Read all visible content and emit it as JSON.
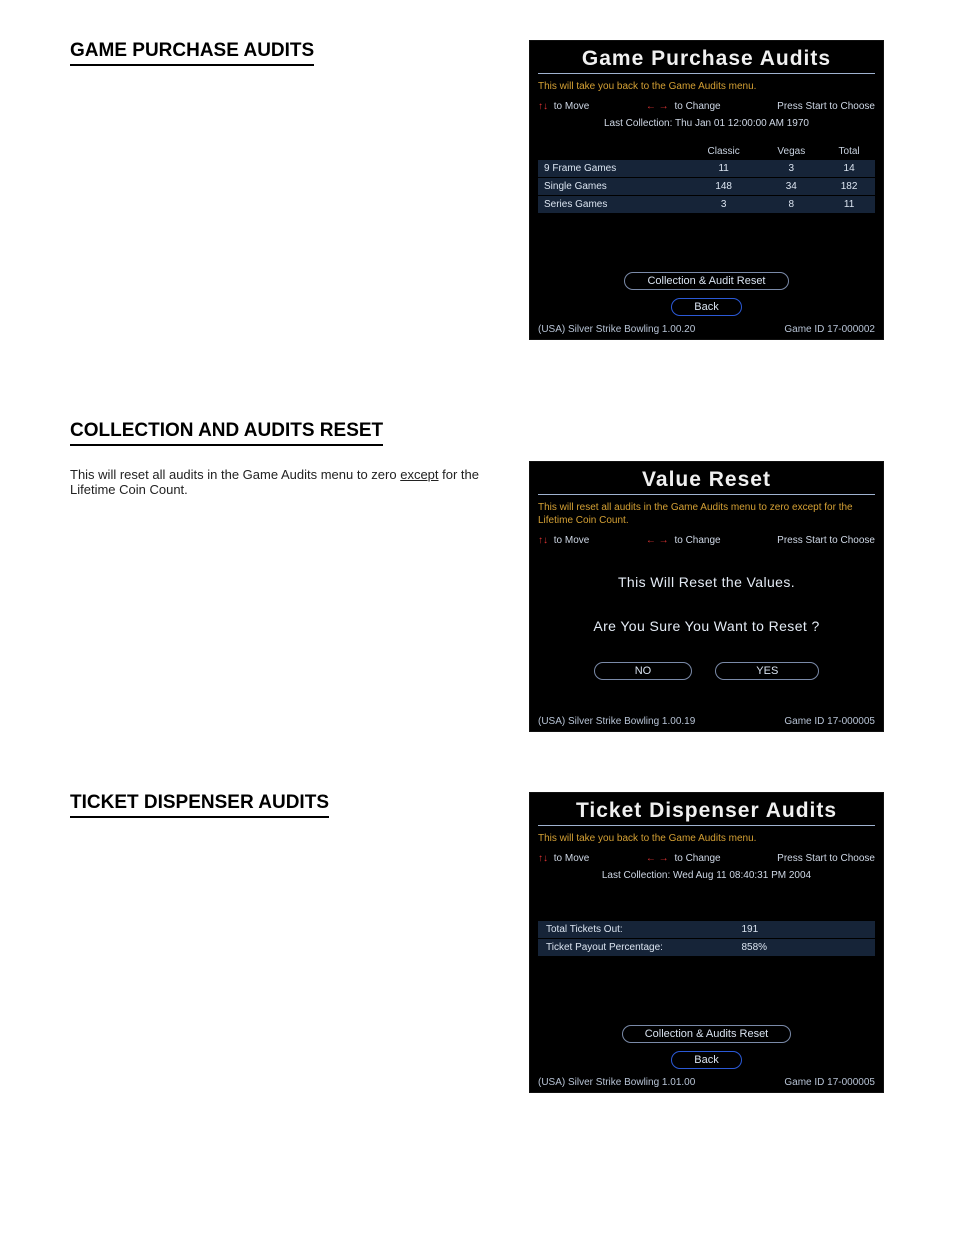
{
  "sections": {
    "purchase": {
      "heading": "GAME PURCHASE AUDITS"
    },
    "reset": {
      "heading": "COLLECTION AND AUDITS RESET",
      "note_pre": "This will reset all audits in the Game Audits menu to zero ",
      "note_u": "except",
      "note_post": " for the Lifetime Coin Count."
    },
    "ticket": {
      "heading": "TICKET DISPENSER AUDITS"
    }
  },
  "screen1": {
    "title": "Game Purchase Audits",
    "help": "This will take you back to the Game Audits menu.",
    "move": "to Move",
    "change": "to Change",
    "start": "Press Start to Choose",
    "collection_label": "Last Collection:",
    "collection_value": "Thu Jan 01 12:00:00 AM 1970",
    "cols": [
      "",
      "Classic",
      "Vegas",
      "Total"
    ],
    "rows": [
      [
        "9 Frame Games",
        "11",
        "3",
        "14"
      ],
      [
        "Single Games",
        "148",
        "34",
        "182"
      ],
      [
        "Series Games",
        "3",
        "8",
        "11"
      ]
    ],
    "btn_reset": "Collection & Audit Reset",
    "btn_back": "Back",
    "foot_left": "(USA) Silver Strike Bowling 1.00.20",
    "foot_right": "Game ID 17-000002"
  },
  "screen2": {
    "title": "Value Reset",
    "help": "This will reset all audits in the Game Audits menu to zero except for the Lifetime Coin Count.",
    "move": "to Move",
    "change": "to Change",
    "start": "Press Start to Choose",
    "msg1": "This Will Reset the Values.",
    "msg2": "Are You Sure You Want to Reset ?",
    "btn_no": "NO",
    "btn_yes": "YES",
    "foot_left": "(USA) Silver Strike Bowling 1.00.19",
    "foot_right": "Game ID 17-000005"
  },
  "screen3": {
    "title": "Ticket Dispenser Audits",
    "help": "This will take you back to the Game Audits menu.",
    "move": "to Move",
    "change": "to Change",
    "start": "Press Start to Choose",
    "collection_label": "Last Collection:",
    "collection_value": "Wed Aug 11 08:40:31 PM 2004",
    "rows": [
      [
        "Total Tickets Out:",
        "191"
      ],
      [
        "Ticket Payout Percentage:",
        "858%"
      ]
    ],
    "btn_reset": "Collection & Audits Reset",
    "btn_back": "Back",
    "foot_left": "(USA) Silver Strike Bowling 1.01.00",
    "foot_right": "Game ID 17-000005"
  }
}
